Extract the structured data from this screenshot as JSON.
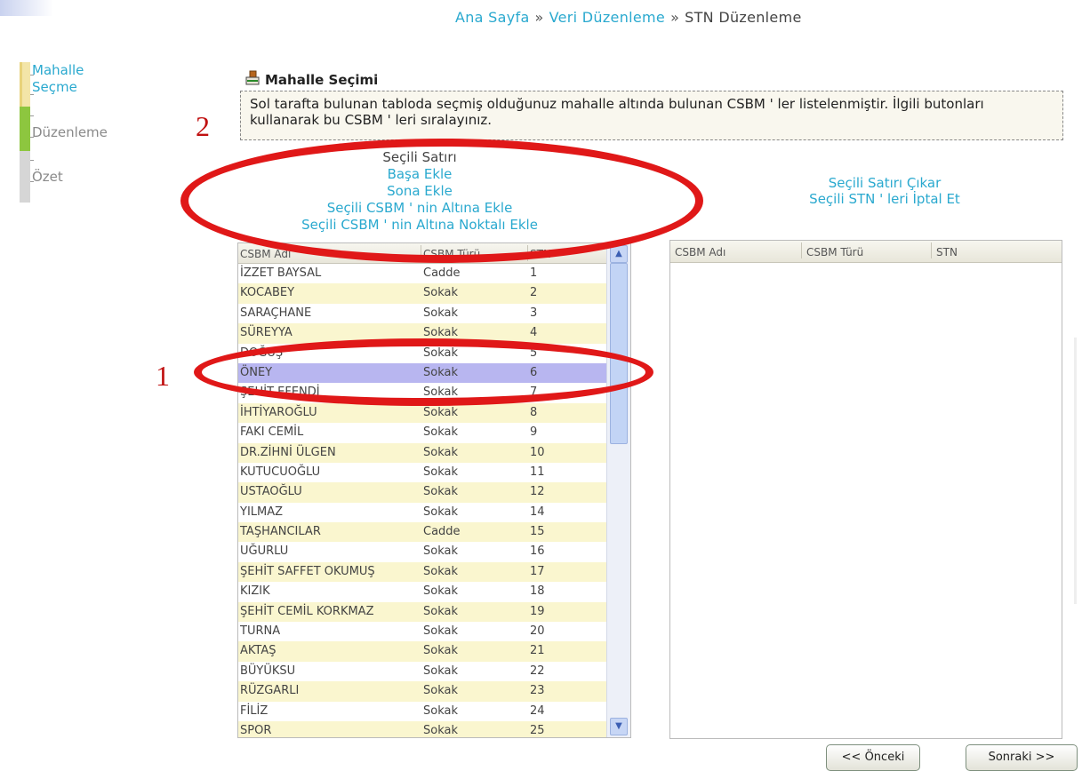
{
  "breadcrumb": {
    "home": "Ana Sayfa",
    "separator": "»",
    "data_edit": "Veri Düzenleme",
    "current": "STN Düzenleme"
  },
  "steps": [
    {
      "label": "Mahalle Seçme",
      "state": "active"
    },
    {
      "label": "Düzenleme",
      "state": "inactive"
    },
    {
      "label": "Özet",
      "state": "inactive"
    }
  ],
  "section": {
    "title": "Mahalle Seçimi",
    "description": "Sol tarafta bulunan tabloda seçmiş olduğunuz mahalle altında bulunan CSBM ' ler listelenmiştir. İlgili butonları kullanarak bu CSBM ' leri sıralayınız."
  },
  "left_actions": {
    "heading": "Seçili Satırı",
    "add_start": "Başa Ekle",
    "add_end": "Sona Ekle",
    "add_below": "Seçili CSBM ' nin Altına Ekle",
    "add_below_dotted": "Seçili CSBM ' nin Altına Noktalı Ekle"
  },
  "right_actions": {
    "remove_selected": "Seçili Satırı Çıkar",
    "cancel_selected": "Seçili STN ' leri İptal Et"
  },
  "left_grid": {
    "columns": [
      "CSBM Adı",
      "CSBM Türü",
      "STN"
    ],
    "rows": [
      [
        "İZZET BAYSAL",
        "Cadde",
        "1"
      ],
      [
        "KOCABEY",
        "Sokak",
        "2"
      ],
      [
        "SARAÇHANE",
        "Sokak",
        "3"
      ],
      [
        "SÜREYYA",
        "Sokak",
        "4"
      ],
      [
        "DOĞUŞ",
        "Sokak",
        "5"
      ],
      [
        "ÖNEY",
        "Sokak",
        "6"
      ],
      [
        "ŞEHİT EFENDİ",
        "Sokak",
        "7"
      ],
      [
        "İHTİYAROĞLU",
        "Sokak",
        "8"
      ],
      [
        "FAKI CEMİL",
        "Sokak",
        "9"
      ],
      [
        "DR.ZİHNİ ÜLGEN",
        "Sokak",
        "10"
      ],
      [
        "KUTUCUOĞLU",
        "Sokak",
        "11"
      ],
      [
        "USTAOĞLU",
        "Sokak",
        "12"
      ],
      [
        "YILMAZ",
        "Sokak",
        "14"
      ],
      [
        "TAŞHANCILAR",
        "Cadde",
        "15"
      ],
      [
        "UĞURLU",
        "Sokak",
        "16"
      ],
      [
        "ŞEHİT SAFFET OKUMUŞ",
        "Sokak",
        "17"
      ],
      [
        "KIZIK",
        "Sokak",
        "18"
      ],
      [
        "ŞEHİT CEMİL KORKMAZ",
        "Sokak",
        "19"
      ],
      [
        "TURNA",
        "Sokak",
        "20"
      ],
      [
        "AKTAŞ",
        "Sokak",
        "21"
      ],
      [
        "BÜYÜKSU",
        "Sokak",
        "22"
      ],
      [
        "RÜZGARLI",
        "Sokak",
        "23"
      ],
      [
        "FİLİZ",
        "Sokak",
        "24"
      ],
      [
        "SPOR",
        "Sokak",
        "25"
      ]
    ],
    "selected_row": "ÖNEY"
  },
  "right_grid": {
    "columns": [
      "CSBM Adı",
      "CSBM Türü",
      "STN"
    ]
  },
  "annotations": {
    "mark_1": "1",
    "mark_2": "2",
    "color": "#e01818"
  },
  "buttons": {
    "prev": "<< Önceki",
    "next": "Sonraki >>"
  },
  "colors": {
    "link": "#2aa9cf",
    "row_alt": "#faf6cf",
    "row_selected": "#b8b6f0"
  }
}
